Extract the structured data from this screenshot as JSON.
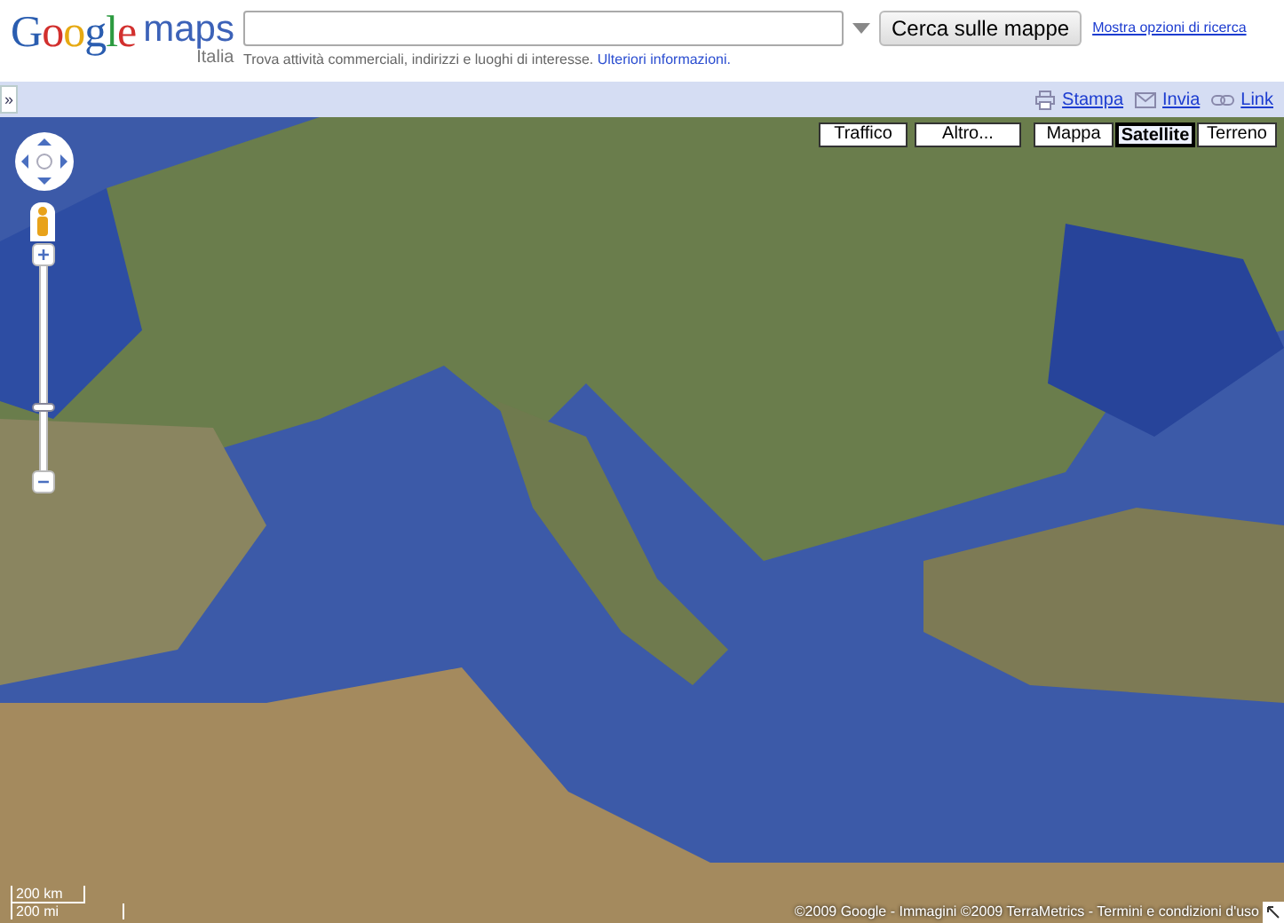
{
  "header": {
    "logo": "Google",
    "product": "maps",
    "region": "Italia",
    "hint": "Trova attività commerciali, indirizzi e luoghi di interesse.",
    "hint_link": "Ulteriori informazioni.",
    "search_button": "Cerca sulle mappe",
    "options_link": "Mostra opzioni di ricerca"
  },
  "toolbar": {
    "collapse": "»",
    "links": [
      {
        "kind": "print",
        "label": "Stampa"
      },
      {
        "kind": "mail",
        "label": "Invia"
      },
      {
        "kind": "link",
        "label": "Link"
      }
    ]
  },
  "map": {
    "overlay_buttons": [
      "Traffico",
      "Altro..."
    ],
    "map_types": [
      {
        "label": "Mappa",
        "selected": false
      },
      {
        "label": "Satellite",
        "selected": true
      },
      {
        "label": "Terreno",
        "selected": false
      }
    ],
    "zoom": {
      "level": 0.3
    },
    "scale": [
      "200 km",
      "200 mi"
    ],
    "copyright": "©2009 Google - Immagini ©2009 TerraMetrics - Termini e condizioni d'uso"
  }
}
